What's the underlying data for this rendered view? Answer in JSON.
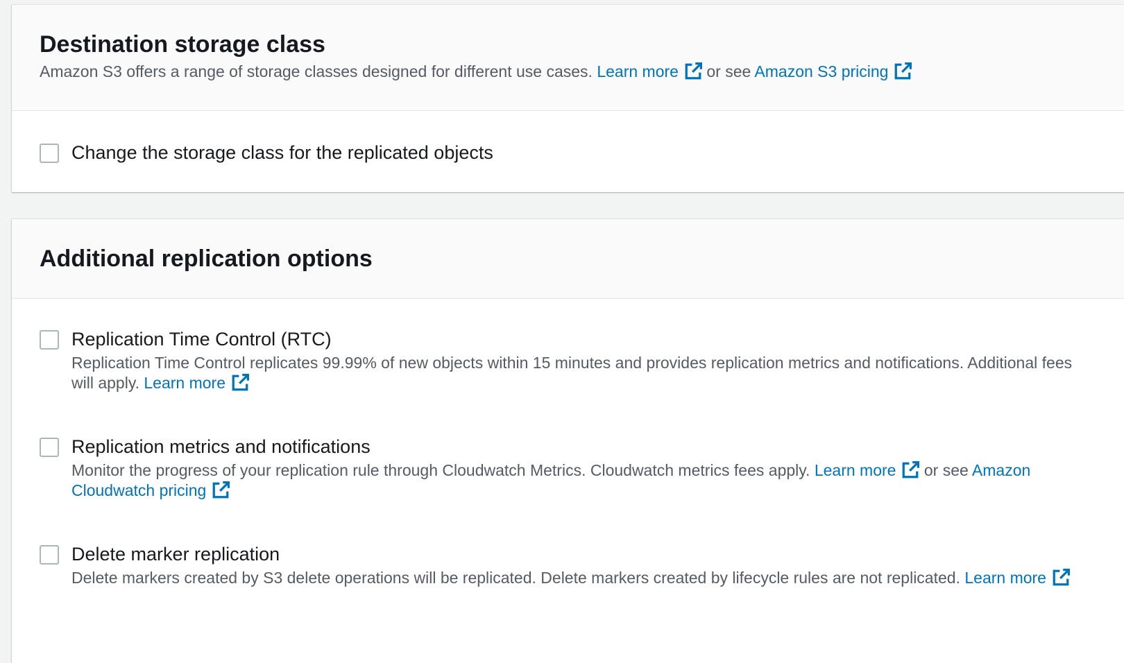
{
  "storage_class": {
    "title": "Destination storage class",
    "description": "Amazon S3 offers a range of storage classes designed for different use cases.",
    "learn_more": "Learn more",
    "or_see": "or see",
    "pricing_link": "Amazon S3 pricing",
    "checkbox_label": "Change the storage class for the replicated objects",
    "checked": false
  },
  "additional": {
    "title": "Additional replication options",
    "options": [
      {
        "label": "Replication Time Control (RTC)",
        "description": "Replication Time Control replicates 99.99% of new objects within 15 minutes and provides replication metrics and notifications. Additional fees will apply.",
        "learn_more": "Learn more",
        "checked": false
      },
      {
        "label": "Replication metrics and notifications",
        "description": "Monitor the progress of your replication rule through Cloudwatch Metrics. Cloudwatch metrics fees apply.",
        "learn_more": "Learn more",
        "or_see": "or see",
        "pricing_link": "Amazon Cloudwatch pricing",
        "checked": false
      },
      {
        "label": "Delete marker replication",
        "description": "Delete markers created by S3 delete operations will be replicated. Delete markers created by lifecycle rules are not replicated.",
        "learn_more": "Learn more",
        "checked": false
      }
    ]
  },
  "icons": {
    "external_link": "external-link-icon"
  },
  "colors": {
    "link": "#0073bb",
    "text": "#16191f",
    "muted": "#545b64",
    "background": "#f2f3f3"
  }
}
